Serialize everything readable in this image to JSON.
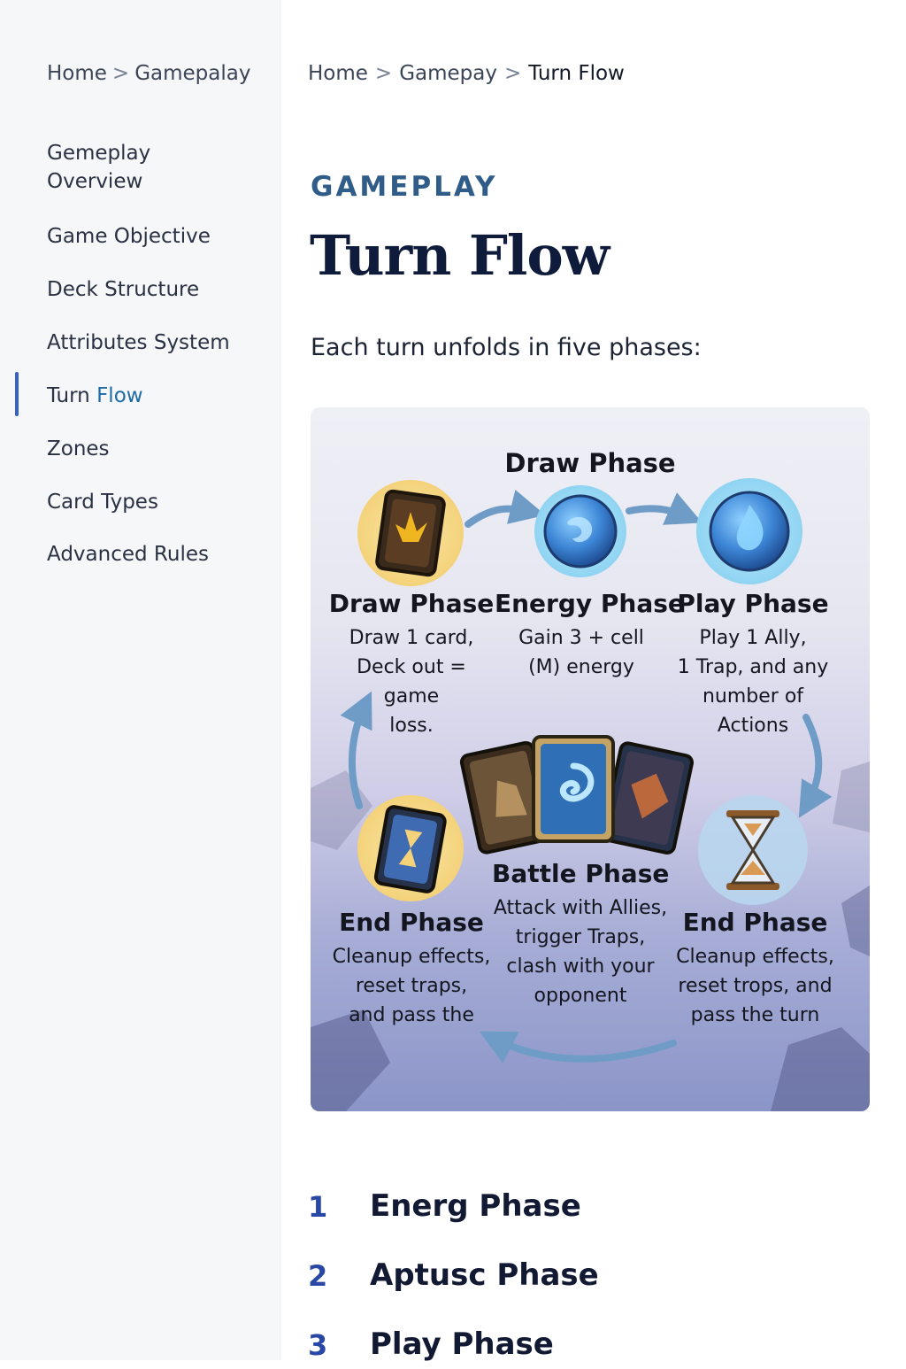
{
  "sidebar": {
    "breadcrumb": {
      "home": "Home",
      "sep": ">",
      "section": "Gamepalay"
    },
    "items": [
      {
        "label": "Gemeplay",
        "label2": "Overview"
      },
      {
        "label": "Game Objective"
      },
      {
        "label": "Deck Structure"
      },
      {
        "label": "Attributes System"
      },
      {
        "label_a": "Turn ",
        "label_b": "Flow",
        "active": true
      },
      {
        "label": "Zones"
      },
      {
        "label": "Card Types"
      },
      {
        "label": "Advanced Rules"
      }
    ]
  },
  "breadcrumb": {
    "home": "Home",
    "sep": ">",
    "section": "Gamepay",
    "current": "Turn Flow"
  },
  "eyebrow": "GAMEPLAY",
  "title": "Turn Flow",
  "intro": "Each turn unfolds in five phases:",
  "diagram": {
    "top_title": "Draw Phase",
    "phases": [
      {
        "name": "Draw Phase",
        "desc": [
          "Draw 1 card,",
          "Deck out = game",
          "loss."
        ]
      },
      {
        "name": "Energy Phase",
        "desc": [
          "Gain 3 + cell",
          "(M) energy"
        ]
      },
      {
        "name": "Play Phase",
        "desc": [
          "Play 1 Ally,",
          "1 Trap, and any",
          "number of Actions"
        ]
      },
      {
        "name": "End Phase",
        "desc": [
          "Cleanup effects,",
          "reset traps,",
          "and pass the"
        ]
      },
      {
        "name": "Battle Phase",
        "desc": [
          "Attack with Allies,",
          "trigger Traps,",
          "clash with your",
          "opponent"
        ]
      },
      {
        "name": "End Phase",
        "desc": [
          "Cleanup effects,",
          "reset trops, and",
          "pass the turn"
        ]
      }
    ]
  },
  "steps": [
    {
      "num": "1",
      "label": "Energ Phase"
    },
    {
      "num": "2",
      "label": "Aptusc Phase"
    },
    {
      "num": "3",
      "label": "Play Phase"
    }
  ]
}
